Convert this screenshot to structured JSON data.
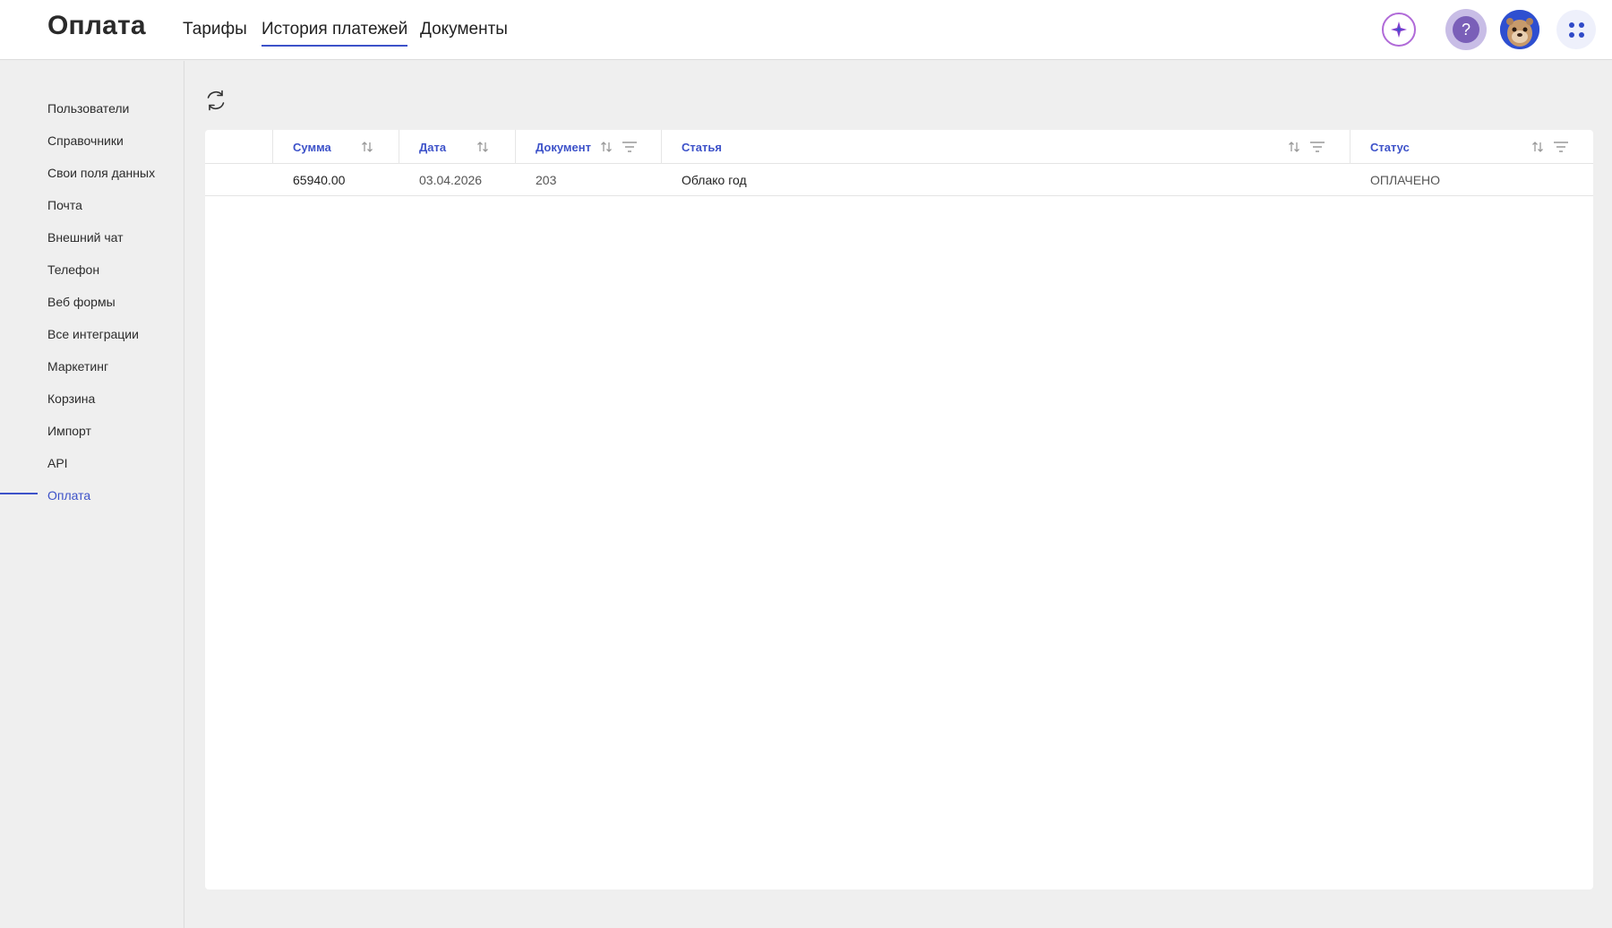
{
  "header": {
    "title": "Оплата",
    "tabs": [
      {
        "label": "Тарифы",
        "active": false
      },
      {
        "label": "История платежей",
        "active": true
      },
      {
        "label": "Документы",
        "active": false
      }
    ],
    "icons": [
      "ai-sparkle-icon",
      "help-icon",
      "avatar",
      "apps-grid-icon"
    ],
    "help_glyph": "?"
  },
  "sidebar": {
    "items": [
      {
        "label": "Пользователи"
      },
      {
        "label": "Справочники"
      },
      {
        "label": "Свои поля данных"
      },
      {
        "label": "Почта"
      },
      {
        "label": "Внешний чат"
      },
      {
        "label": "Телефон"
      },
      {
        "label": "Веб формы"
      },
      {
        "label": "Все интеграции"
      },
      {
        "label": "Маркетинг"
      },
      {
        "label": "Корзина"
      },
      {
        "label": "Импорт"
      },
      {
        "label": "API"
      },
      {
        "label": "Оплата",
        "active": true
      }
    ]
  },
  "table": {
    "columns": [
      {
        "label": "Сумма",
        "sortable": true,
        "filterable": false
      },
      {
        "label": "Дата",
        "sortable": true,
        "filterable": false
      },
      {
        "label": "Документ",
        "sortable": true,
        "filterable": true
      },
      {
        "label": "Статья",
        "sortable": true,
        "filterable": true
      },
      {
        "label": "Статус",
        "sortable": true,
        "filterable": true
      }
    ],
    "rows": [
      {
        "amount": "65940.00",
        "date": "03.04.2026",
        "document": "203",
        "article": "Облако год",
        "status": "ОПЛАЧЕНО"
      }
    ]
  },
  "colors": {
    "accent": "#3d52c9",
    "background": "#efefef",
    "ai_ring": "#b06ad8",
    "help_bg": "#7a5fb8"
  }
}
